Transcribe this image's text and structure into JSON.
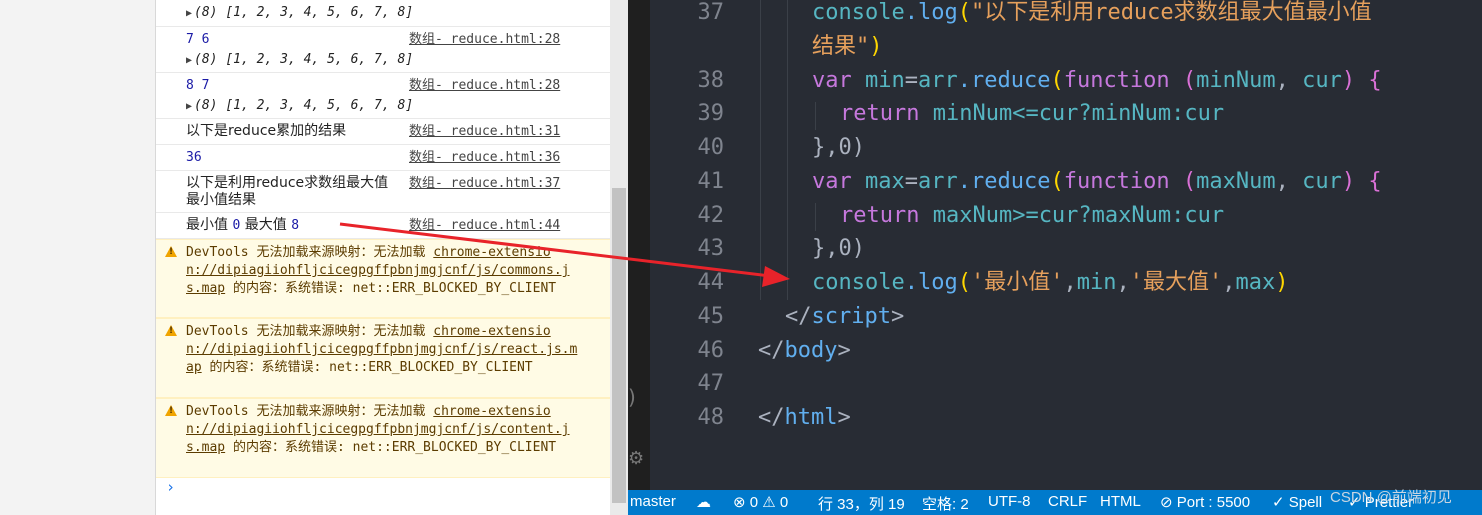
{
  "console": {
    "rows": [
      {
        "msg": "",
        "array": "(8) [1, 2, 3, 4, 5, 6, 7, 8]"
      },
      {
        "msg": "7 6",
        "src": "数组- reduce.html:28",
        "array": "(8) [1, 2, 3, 4, 5, 6, 7, 8]"
      },
      {
        "msg": "8 7",
        "src": "数组- reduce.html:28",
        "array": "(8) [1, 2, 3, 4, 5, 6, 7, 8]"
      },
      {
        "msg": "以下是reduce累加的结果",
        "src": "数组- reduce.html:31"
      },
      {
        "msg": "36",
        "src": "数组- reduce.html:36"
      },
      {
        "msg": "以下是利用reduce求数组最大值最小值结果",
        "src": "数组- reduce.html:37"
      },
      {
        "msg_min_label": "最小值",
        "msg_min": "0",
        "msg_max_label": "最大值",
        "msg_max": "8",
        "src": "数组- reduce.html:44"
      }
    ],
    "warnings": [
      {
        "prefix": "DevTools 无法加载来源映射：无法加载 ",
        "link": "chrome-extension://dipiagiiohfljcicegpgffpbnjmgjcnf/js/commons.js.map",
        "suffix": " 的内容：系统错误: net::ERR_BLOCKED_BY_CLIENT"
      },
      {
        "prefix": "DevTools 无法加载来源映射：无法加载 ",
        "link": "chrome-extension://dipiagiiohfljcicegpgffpbnjmgjcnf/js/react.js.map",
        "suffix": " 的内容：系统错误: net::ERR_BLOCKED_BY_CLIENT"
      },
      {
        "prefix": "DevTools 无法加载来源映射：无法加载 ",
        "link": "chrome-extension://dipiagiiohfljcicegpgffpbnjmgjcnf/js/content.js.map",
        "suffix": " 的内容：系统错误: net::ERR_BLOCKED_BY_CLIENT"
      }
    ],
    "prompt": "›"
  },
  "editor": {
    "line_numbers": [
      "37",
      "",
      "38",
      "39",
      "40",
      "41",
      "42",
      "43",
      "44",
      "45",
      "46",
      "47",
      "48"
    ],
    "code": {
      "l37a_obj": "console",
      "l37a_fn": ".log",
      "l37a_str": "\"以下是利用reduce求数组最大值最小值",
      "l37b_str": "结果\"",
      "l38_kw": "var",
      "l38_var": " min",
      "l38_arr": "arr",
      "l38_fn": ".reduce",
      "l38_kw2": "function",
      "l38_p1": "minNum",
      "l38_p2": "cur",
      "l39_kw": "return",
      "l39_expr": " minNum<=cur?minNum:cur",
      "l40": "},0)",
      "l41_kw": "var",
      "l41_var": " max",
      "l41_arr": "arr",
      "l41_fn": ".reduce",
      "l41_kw2": "function",
      "l41_p1": "maxNum",
      "l41_p2": "cur",
      "l42_kw": "return",
      "l42_expr": " maxNum>=cur?maxNum:cur",
      "l43": "},0)",
      "l44_obj": "console",
      "l44_fn": ".log",
      "l44_s1": "'最小值'",
      "l44_v1": "min",
      "l44_s2": "'最大值'",
      "l44_v2": "max",
      "l45": "script",
      "l46": "body",
      "l48": "html"
    }
  },
  "statusbar": {
    "branch": "master",
    "errors": "⊗ 0 ⚠ 0",
    "position": "行 33，列 19",
    "spaces": "空格: 2",
    "encoding": "UTF-8",
    "eol": "CRLF",
    "language": "HTML",
    "port": "⊘ Port : 5500",
    "spell": "✓ Spell",
    "prettier": "✓ Prettier"
  },
  "watermark": "CSDN @前端初见",
  "colors": {
    "statusbar": "#007acc",
    "editor_bg": "#282c34",
    "arrow": "#e8232a"
  }
}
